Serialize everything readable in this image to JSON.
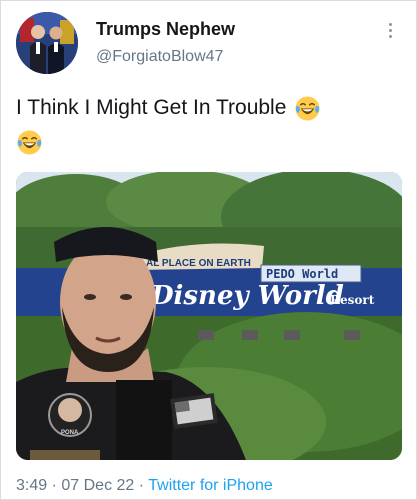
{
  "user": {
    "display_name": "Trumps Nephew",
    "handle": "@ForgiatoBlow47"
  },
  "tweet": {
    "text": "I Think I Might Get In Trouble",
    "emoji_1": "face-with-tears-of-joy",
    "emoji_2": "face-with-tears-of-joy"
  },
  "media": {
    "sign_top": "AL PLACE ON EARTH",
    "sign_main": "Disney World",
    "sign_resort": "Resort",
    "sign_patch": "PEDO World",
    "patch_text": "PONA"
  },
  "footer": {
    "time": "3:49",
    "dot_1": "·",
    "date": "07 Dec 22",
    "dot_2": "·",
    "source": "Twitter for iPhone"
  },
  "colors": {
    "text_primary": "#14171a",
    "text_secondary": "#657786",
    "link": "#1da1f2"
  }
}
